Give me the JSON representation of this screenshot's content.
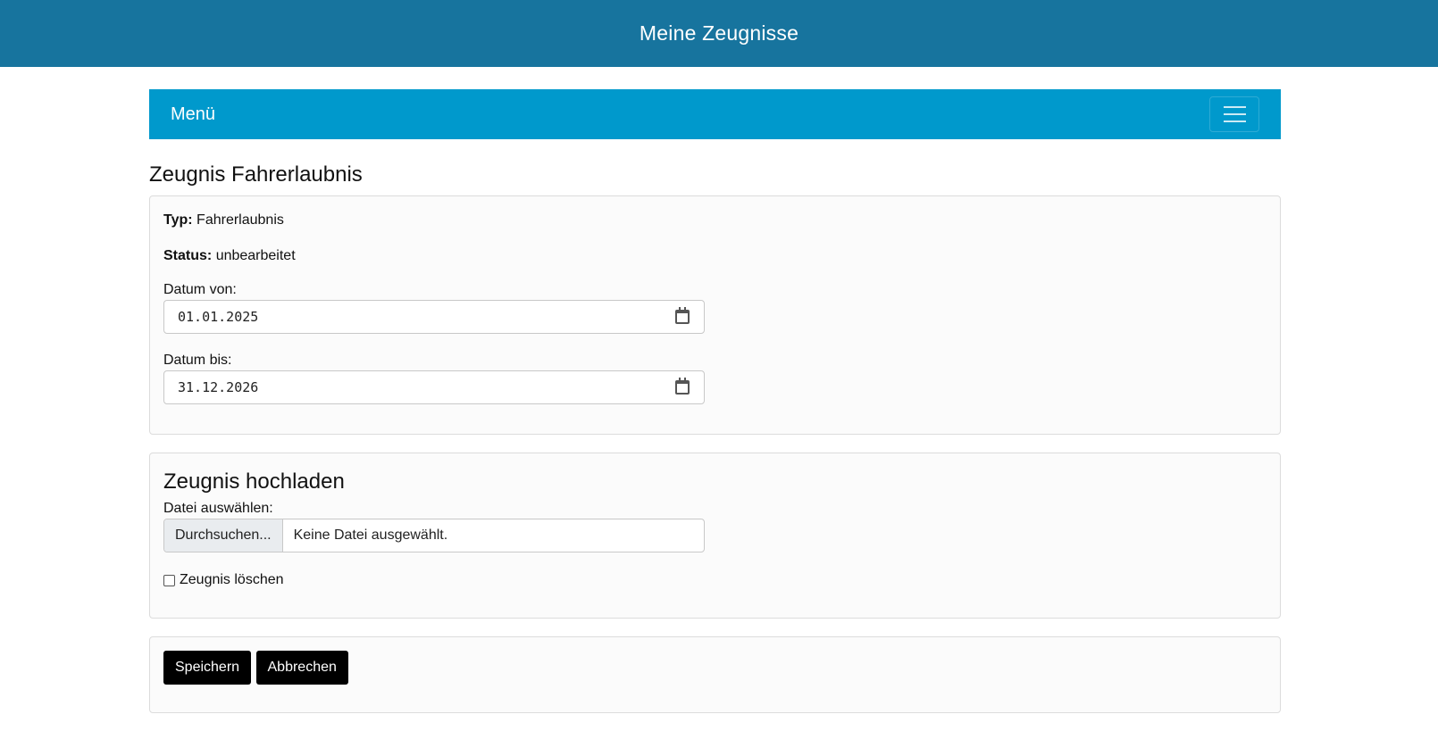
{
  "header": {
    "title": "Meine Zeugnisse"
  },
  "navbar": {
    "brand": "Menü",
    "toggler_icon": "hamburger-icon"
  },
  "page": {
    "title": "Zeugnis Fahrerlaubnis"
  },
  "details": {
    "type_label": "Typ:",
    "type_value": "Fahrerlaubnis",
    "status_label": "Status:",
    "status_value": "unbearbeitet",
    "date_from_label": "Datum von:",
    "date_from_value": "01.01.2025",
    "date_to_label": "Datum bis:",
    "date_to_value": "31.12.2026"
  },
  "upload": {
    "title": "Zeugnis hochladen",
    "file_label": "Datei auswählen:",
    "browse_label": "Durchsuchen...",
    "no_file_text": "Keine Datei ausgewählt.",
    "delete_label": "Zeugnis löschen",
    "delete_checked": false
  },
  "actions": {
    "save_label": "Speichern",
    "cancel_label": "Abbrechen"
  },
  "colors": {
    "header_bg": "#17749e",
    "navbar_bg": "#0099cc",
    "button_bg": "#000000"
  }
}
